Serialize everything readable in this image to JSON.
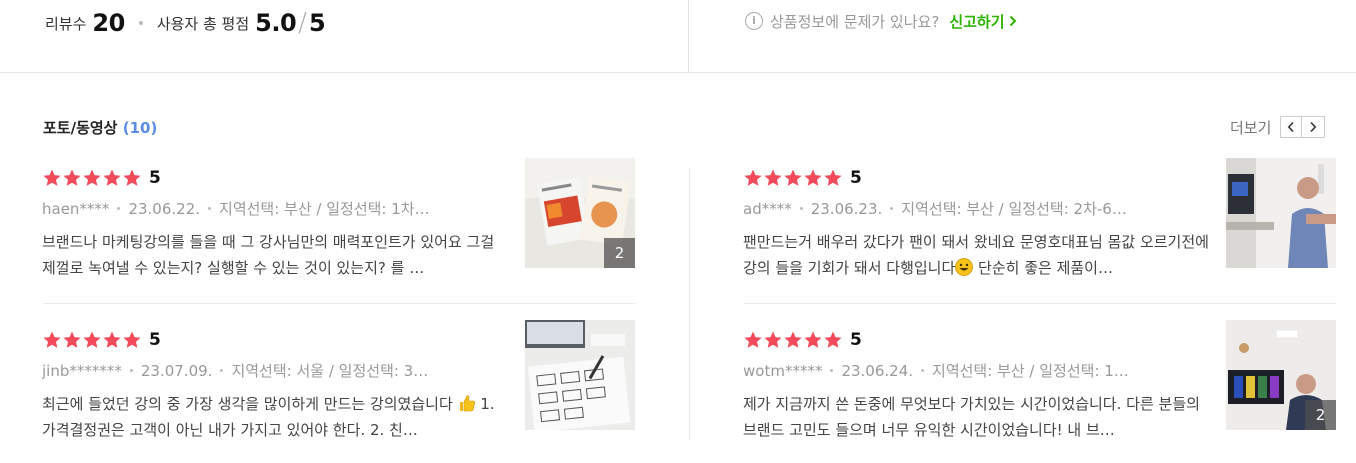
{
  "summary": {
    "review_count_label": "리뷰수",
    "review_count": "20",
    "rating_label": "사용자 총 평점",
    "rating": "5.0",
    "rating_max": "5"
  },
  "report": {
    "question": "상품정보에 문제가 있나요?",
    "link_label": "신고하기"
  },
  "photo_section": {
    "title": "포토/동영상",
    "count": "(10)",
    "more_label": "더보기"
  },
  "colors": {
    "star": "#f44b5b",
    "accent_green": "#2db400",
    "count_blue": "#5b8de6"
  },
  "reviews": [
    {
      "score": "5",
      "user": "haen****",
      "date": "23.06.22.",
      "options": "지역선택: 부산 / 일정선택: 1차…",
      "text": "브랜드나 마케팅강의를 들을 때 그 강사님만의 매력포인트가 있어요 그걸 제껄로 녹여낼 수 있는지? 실행할 수 있는 것이 있는지? 를 …",
      "photo_count": "2"
    },
    {
      "score": "5",
      "user": "ad****",
      "date": "23.06.23.",
      "options": "지역선택: 부산 / 일정선택: 2차-6…",
      "text_a": "팬만드는거 배우러 갔다가 팬이 돼서 왔네요 문영호대표님 몸값 오르기전에 강의 들을 기회가 돼서 다행입니다",
      "text_b": " 단순히 좋은 제품이…",
      "photo_count": ""
    },
    {
      "score": "5",
      "user": "jinb*******",
      "date": "23.07.09.",
      "options": "지역선택: 서울 / 일정선택: 3…",
      "text_a": "최근에 들었던 강의 중 가장 생각을 많이하게 만드는 강의였습니다 ",
      "text_b": " 1. 가격결정권은 고객이 아닌 내가 가지고 있어야 한다. 2. 친…",
      "photo_count": ""
    },
    {
      "score": "5",
      "user": "wotm*****",
      "date": "23.06.24.",
      "options": "지역선택: 부산 / 일정선택: 1…",
      "text": "제가 지금까지 쓴 돈중에 무엇보다 가치있는 시간이었습니다. 다른 분들의 브랜드 고민도 들으며 너무 유익한 시간이었습니다! 내 브…",
      "photo_count": "2"
    }
  ]
}
